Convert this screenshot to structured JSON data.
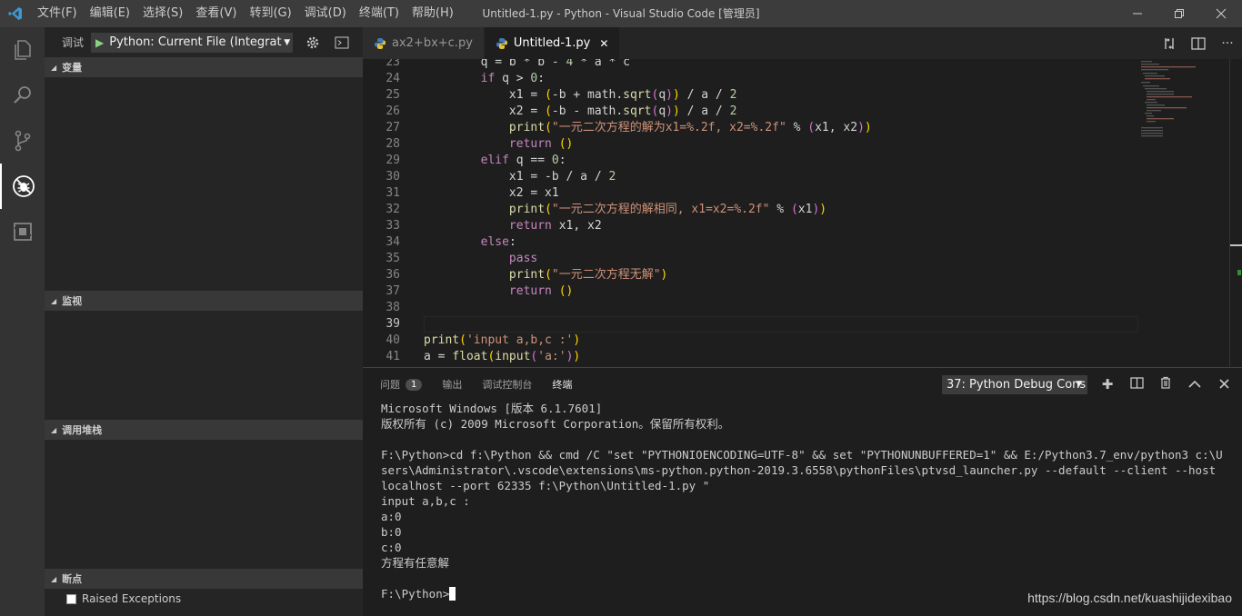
{
  "titlebar": {
    "menu": [
      "文件(F)",
      "编辑(E)",
      "选择(S)",
      "查看(V)",
      "转到(G)",
      "调试(D)",
      "终端(T)",
      "帮助(H)"
    ],
    "title": "Untitled-1.py - Python - Visual Studio Code [管理员]"
  },
  "sidebar": {
    "debug_label": "调试",
    "config": "Python: Current File (Integrated",
    "sections": {
      "variables": "变量",
      "watch": "监视",
      "callstack": "调用堆栈",
      "breakpoints": "断点"
    },
    "breakpoints": [
      "Raised Exceptions"
    ]
  },
  "tabs": [
    {
      "label": "ax2+bx+c.py",
      "active": false
    },
    {
      "label": "Untitled-1.py",
      "active": true
    }
  ],
  "editor": {
    "current_line": 39,
    "lines": [
      {
        "n": 23,
        "code": "        q = b * b - 4 * a * c"
      },
      {
        "n": 24,
        "code": "        if q > 0:"
      },
      {
        "n": 25,
        "code": "            x1 = (-b + math.sqrt(q)) / a / 2"
      },
      {
        "n": 26,
        "code": "            x2 = (-b - math.sqrt(q)) / a / 2"
      },
      {
        "n": 27,
        "code": "            print(\"一元二次方程的解为x1=%.2f, x2=%.2f\" % (x1, x2))"
      },
      {
        "n": 28,
        "code": "            return ()"
      },
      {
        "n": 29,
        "code": "        elif q == 0:"
      },
      {
        "n": 30,
        "code": "            x1 = -b / a / 2"
      },
      {
        "n": 31,
        "code": "            x2 = x1"
      },
      {
        "n": 32,
        "code": "            print(\"一元二次方程的解相同, x1=x2=%.2f\" % (x1))"
      },
      {
        "n": 33,
        "code": "            return x1, x2"
      },
      {
        "n": 34,
        "code": "        else:"
      },
      {
        "n": 35,
        "code": "            pass"
      },
      {
        "n": 36,
        "code": "            print(\"一元二次方程无解\")"
      },
      {
        "n": 37,
        "code": "            return ()"
      },
      {
        "n": 38,
        "code": ""
      },
      {
        "n": 39,
        "code": ""
      },
      {
        "n": 40,
        "code": "print('input a,b,c :')"
      },
      {
        "n": 41,
        "code": "a = float(input('a:'))"
      }
    ]
  },
  "panel": {
    "tabs": [
      "问题",
      "输出",
      "调试控制台",
      "终端"
    ],
    "problems_count": "1",
    "active_tab": "终端",
    "terminal_select": "37: Python Debug Cons",
    "terminal_lines": [
      "Microsoft Windows [版本 6.1.7601]",
      "版权所有 (c) 2009 Microsoft Corporation。保留所有权利。",
      "",
      "F:\\Python>cd f:\\Python && cmd /C \"set \"PYTHONIOENCODING=UTF-8\" && set \"PYTHONUNBUFFERED=1\" && E:/Python3.7_env/python3 c:\\Users\\Administrator\\.vscode\\extensions\\ms-python.python-2019.3.6558\\pythonFiles\\ptvsd_launcher.py --default --client --host localhost --port 62335 f:\\Python\\Untitled-1.py \"",
      "input a,b,c :",
      "a:0",
      "b:0",
      "c:0",
      "方程有任意解",
      ""
    ],
    "prompt": "F:\\Python>"
  },
  "watermark": "https://blog.csdn.net/kuashijidexibao"
}
